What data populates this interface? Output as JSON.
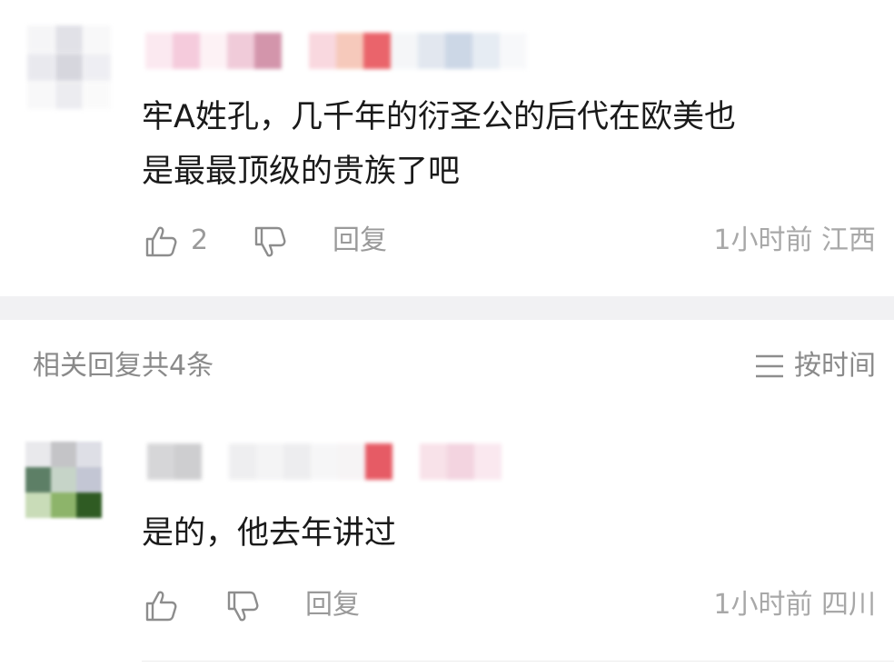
{
  "comment": {
    "text_line1": "牢A姓孔，几千年的衍圣公的后代在欧美也",
    "text_line2": "是最最顶级的贵族了吧",
    "like_count": "2",
    "reply_label": "回复",
    "time_location": "1小时前 江西"
  },
  "replies_header": {
    "count_label": "相关回复共4条",
    "sort_label": "按时间",
    "sort_icon": "menu-lines-icon"
  },
  "reply": {
    "text": "是的，他去年讲过",
    "reply_label": "回复",
    "time_location": "1小时前 四川"
  },
  "colors": {
    "divider_band": "#f1f1f3",
    "muted_text": "#9a9a9a",
    "body_text": "#1a1a1a"
  }
}
